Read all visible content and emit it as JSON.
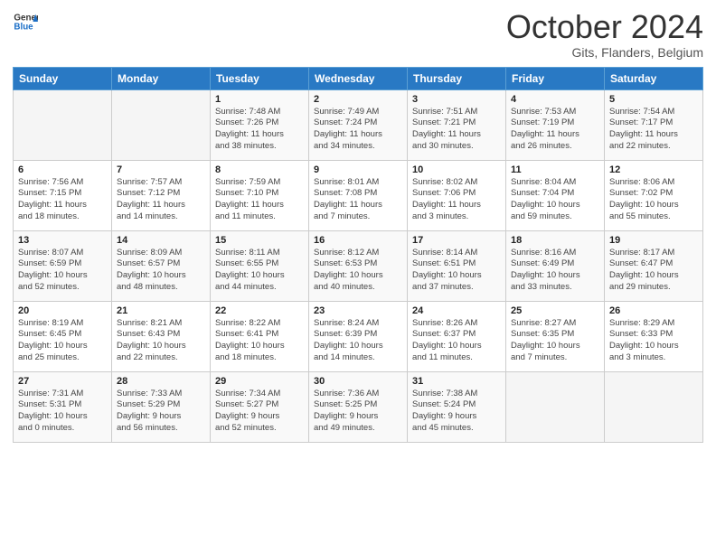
{
  "header": {
    "logo_line1": "General",
    "logo_line2": "Blue",
    "month_title": "October 2024",
    "location": "Gits, Flanders, Belgium"
  },
  "weekdays": [
    "Sunday",
    "Monday",
    "Tuesday",
    "Wednesday",
    "Thursday",
    "Friday",
    "Saturday"
  ],
  "weeks": [
    [
      {
        "day": "",
        "info": ""
      },
      {
        "day": "",
        "info": ""
      },
      {
        "day": "1",
        "info": "Sunrise: 7:48 AM\nSunset: 7:26 PM\nDaylight: 11 hours\nand 38 minutes."
      },
      {
        "day": "2",
        "info": "Sunrise: 7:49 AM\nSunset: 7:24 PM\nDaylight: 11 hours\nand 34 minutes."
      },
      {
        "day": "3",
        "info": "Sunrise: 7:51 AM\nSunset: 7:21 PM\nDaylight: 11 hours\nand 30 minutes."
      },
      {
        "day": "4",
        "info": "Sunrise: 7:53 AM\nSunset: 7:19 PM\nDaylight: 11 hours\nand 26 minutes."
      },
      {
        "day": "5",
        "info": "Sunrise: 7:54 AM\nSunset: 7:17 PM\nDaylight: 11 hours\nand 22 minutes."
      }
    ],
    [
      {
        "day": "6",
        "info": "Sunrise: 7:56 AM\nSunset: 7:15 PM\nDaylight: 11 hours\nand 18 minutes."
      },
      {
        "day": "7",
        "info": "Sunrise: 7:57 AM\nSunset: 7:12 PM\nDaylight: 11 hours\nand 14 minutes."
      },
      {
        "day": "8",
        "info": "Sunrise: 7:59 AM\nSunset: 7:10 PM\nDaylight: 11 hours\nand 11 minutes."
      },
      {
        "day": "9",
        "info": "Sunrise: 8:01 AM\nSunset: 7:08 PM\nDaylight: 11 hours\nand 7 minutes."
      },
      {
        "day": "10",
        "info": "Sunrise: 8:02 AM\nSunset: 7:06 PM\nDaylight: 11 hours\nand 3 minutes."
      },
      {
        "day": "11",
        "info": "Sunrise: 8:04 AM\nSunset: 7:04 PM\nDaylight: 10 hours\nand 59 minutes."
      },
      {
        "day": "12",
        "info": "Sunrise: 8:06 AM\nSunset: 7:02 PM\nDaylight: 10 hours\nand 55 minutes."
      }
    ],
    [
      {
        "day": "13",
        "info": "Sunrise: 8:07 AM\nSunset: 6:59 PM\nDaylight: 10 hours\nand 52 minutes."
      },
      {
        "day": "14",
        "info": "Sunrise: 8:09 AM\nSunset: 6:57 PM\nDaylight: 10 hours\nand 48 minutes."
      },
      {
        "day": "15",
        "info": "Sunrise: 8:11 AM\nSunset: 6:55 PM\nDaylight: 10 hours\nand 44 minutes."
      },
      {
        "day": "16",
        "info": "Sunrise: 8:12 AM\nSunset: 6:53 PM\nDaylight: 10 hours\nand 40 minutes."
      },
      {
        "day": "17",
        "info": "Sunrise: 8:14 AM\nSunset: 6:51 PM\nDaylight: 10 hours\nand 37 minutes."
      },
      {
        "day": "18",
        "info": "Sunrise: 8:16 AM\nSunset: 6:49 PM\nDaylight: 10 hours\nand 33 minutes."
      },
      {
        "day": "19",
        "info": "Sunrise: 8:17 AM\nSunset: 6:47 PM\nDaylight: 10 hours\nand 29 minutes."
      }
    ],
    [
      {
        "day": "20",
        "info": "Sunrise: 8:19 AM\nSunset: 6:45 PM\nDaylight: 10 hours\nand 25 minutes."
      },
      {
        "day": "21",
        "info": "Sunrise: 8:21 AM\nSunset: 6:43 PM\nDaylight: 10 hours\nand 22 minutes."
      },
      {
        "day": "22",
        "info": "Sunrise: 8:22 AM\nSunset: 6:41 PM\nDaylight: 10 hours\nand 18 minutes."
      },
      {
        "day": "23",
        "info": "Sunrise: 8:24 AM\nSunset: 6:39 PM\nDaylight: 10 hours\nand 14 minutes."
      },
      {
        "day": "24",
        "info": "Sunrise: 8:26 AM\nSunset: 6:37 PM\nDaylight: 10 hours\nand 11 minutes."
      },
      {
        "day": "25",
        "info": "Sunrise: 8:27 AM\nSunset: 6:35 PM\nDaylight: 10 hours\nand 7 minutes."
      },
      {
        "day": "26",
        "info": "Sunrise: 8:29 AM\nSunset: 6:33 PM\nDaylight: 10 hours\nand 3 minutes."
      }
    ],
    [
      {
        "day": "27",
        "info": "Sunrise: 7:31 AM\nSunset: 5:31 PM\nDaylight: 10 hours\nand 0 minutes."
      },
      {
        "day": "28",
        "info": "Sunrise: 7:33 AM\nSunset: 5:29 PM\nDaylight: 9 hours\nand 56 minutes."
      },
      {
        "day": "29",
        "info": "Sunrise: 7:34 AM\nSunset: 5:27 PM\nDaylight: 9 hours\nand 52 minutes."
      },
      {
        "day": "30",
        "info": "Sunrise: 7:36 AM\nSunset: 5:25 PM\nDaylight: 9 hours\nand 49 minutes."
      },
      {
        "day": "31",
        "info": "Sunrise: 7:38 AM\nSunset: 5:24 PM\nDaylight: 9 hours\nand 45 minutes."
      },
      {
        "day": "",
        "info": ""
      },
      {
        "day": "",
        "info": ""
      }
    ]
  ]
}
